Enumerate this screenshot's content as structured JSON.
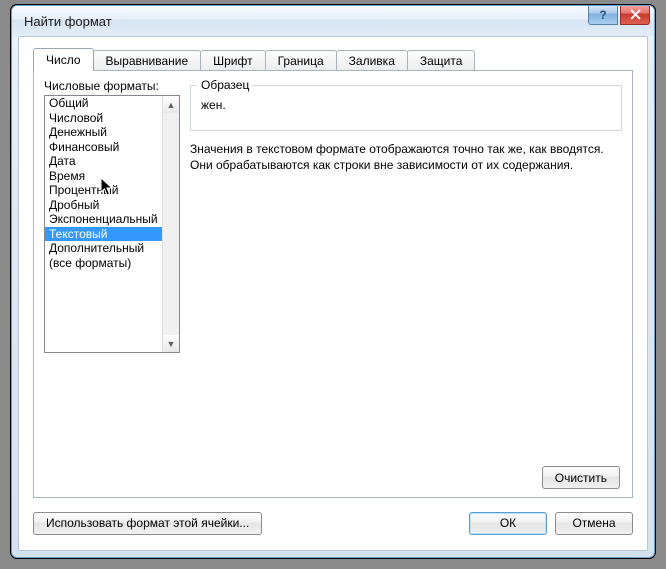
{
  "window": {
    "title": "Найти формат",
    "help": "?",
    "close": "x"
  },
  "tabs": [
    "Число",
    "Выравнивание",
    "Шрифт",
    "Граница",
    "Заливка",
    "Защита"
  ],
  "active_tab_index": 0,
  "number_tab": {
    "formats_label": "Числовые форматы:",
    "formats": [
      "Общий",
      "Числовой",
      "Денежный",
      "Финансовый",
      "Дата",
      "Время",
      "Процентный",
      "Дробный",
      "Экспоненциальный",
      "Текстовый",
      "Дополнительный",
      "(все форматы)"
    ],
    "selected_format_index": 9,
    "sample_label": "Образец",
    "sample_value": "жен.",
    "description": "Значения в текстовом формате отображаются точно так же, как вводятся. Они обрабатываются как строки вне зависимости от их содержания."
  },
  "buttons": {
    "clear": "Очистить",
    "use_cell_format": "Использовать формат этой ячейки...",
    "ok": "ОК",
    "cancel": "Отмена"
  }
}
